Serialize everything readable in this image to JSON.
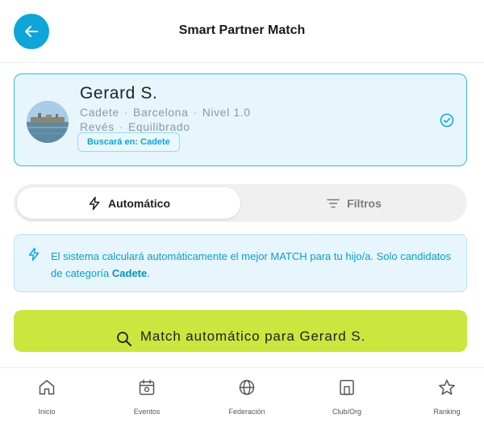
{
  "header": {
    "title": "Smart Partner Match",
    "back_icon": "arrow-left-icon"
  },
  "profile": {
    "name": "Gerard S.",
    "category": "Cadete",
    "city": "Barcelona",
    "level": "Nivel 1.0",
    "hand": "Revés",
    "style": "Equilibrado",
    "search_badge": "Buscará en: Cadete",
    "selected_icon": "check-circle-icon"
  },
  "mode_tabs": [
    {
      "label": "Automático",
      "icon": "lightning-icon",
      "active": true
    },
    {
      "label": "Filtros",
      "icon": "filter-lines-icon",
      "active": false
    }
  ],
  "info": {
    "text_before": "El sistema calculará automáticamente el mejor MATCH para tu hijo/a. Solo candidatos de categoría ",
    "highlight": "Cadete",
    "text_after": ".",
    "icon": "lightning-icon"
  },
  "match_button": {
    "label": "Match automático para Gerard S.",
    "icon": "search-icon"
  },
  "bottom_nav": [
    {
      "label": "Inicio",
      "icon": "home-icon"
    },
    {
      "label": "Eventos",
      "icon": "calendar-icon"
    },
    {
      "label": "Federación",
      "icon": "globe-icon"
    },
    {
      "label": "Club/Org",
      "icon": "building-icon"
    },
    {
      "label": "Ranking",
      "icon": "star-icon"
    }
  ],
  "colors": {
    "accent": "#0ea5d9",
    "card_bg": "#e6f6fc",
    "match_button": "#cbe63f"
  }
}
